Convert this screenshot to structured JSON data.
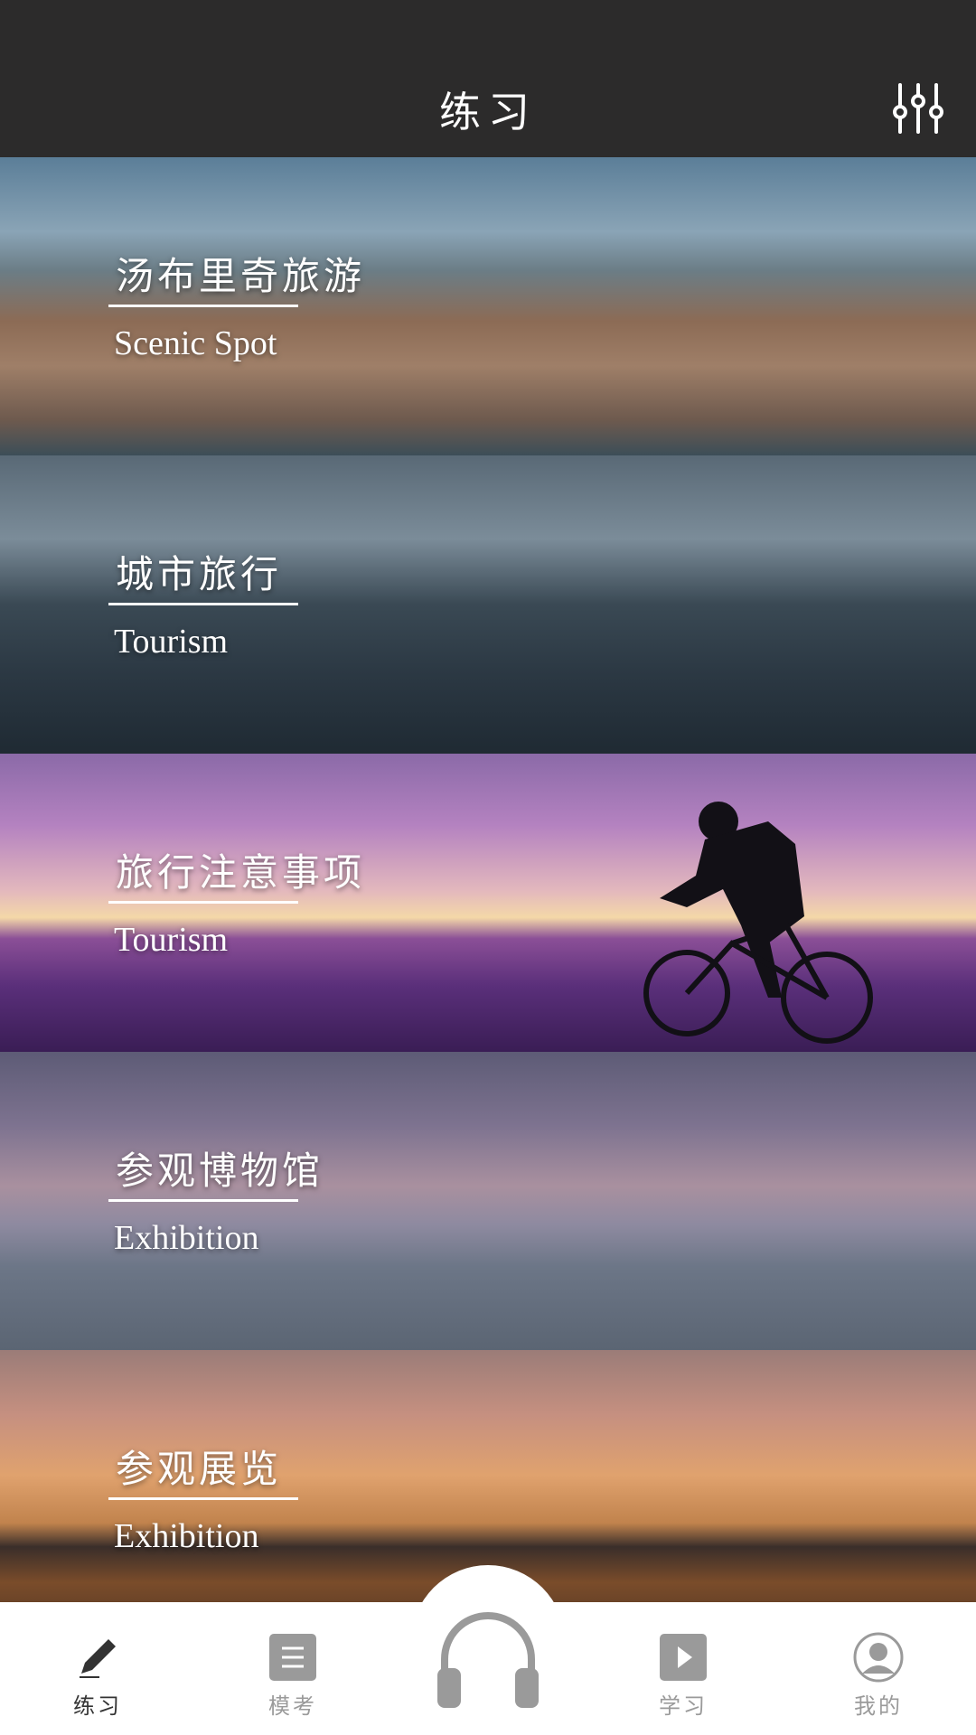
{
  "header": {
    "title": "练习"
  },
  "cards": [
    {
      "title": "汤布里奇旅游",
      "subtitle": "Scenic Spot"
    },
    {
      "title": "城市旅行",
      "subtitle": "Tourism"
    },
    {
      "title": "旅行注意事项",
      "subtitle": "Tourism"
    },
    {
      "title": "参观博物馆",
      "subtitle": "Exhibition"
    },
    {
      "title": "参观展览",
      "subtitle": "Exhibition"
    }
  ],
  "bottom_nav": {
    "items": [
      {
        "label": "练习",
        "icon": "pencil-icon",
        "active": true
      },
      {
        "label": "模考",
        "icon": "document-icon",
        "active": false
      },
      {
        "label": "",
        "icon": "headphones-icon",
        "active": false
      },
      {
        "label": "学习",
        "icon": "play-icon",
        "active": false
      },
      {
        "label": "我的",
        "icon": "user-icon",
        "active": false
      }
    ]
  },
  "colors": {
    "header_bg": "#2c2b2b",
    "nav_active": "#333333",
    "nav_inactive": "#9a9a9a"
  }
}
